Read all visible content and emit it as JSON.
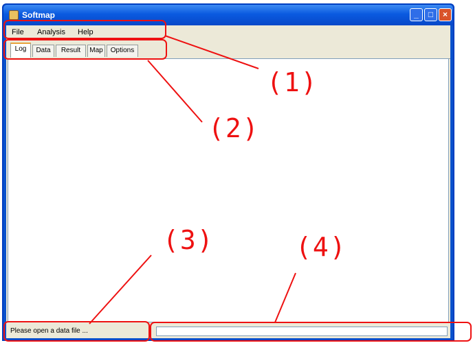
{
  "window": {
    "title": "Softmap",
    "controls": {
      "minimize": "_",
      "maximize": "□",
      "close": "×"
    }
  },
  "menu": {
    "items": [
      "File",
      "Analysis",
      "Help"
    ]
  },
  "tabs": [
    {
      "label": "Log",
      "active": true
    },
    {
      "label": "Data",
      "active": false
    },
    {
      "label": "Result",
      "active": false
    },
    {
      "label": "Map",
      "active": false
    },
    {
      "label": "Options",
      "active": false
    }
  ],
  "status": {
    "message": "Please open a data file ...",
    "progress": 0
  },
  "annotations": {
    "color": "#ee1111",
    "labels": [
      "(1)",
      "(2)",
      "(3)",
      "(4)"
    ]
  }
}
